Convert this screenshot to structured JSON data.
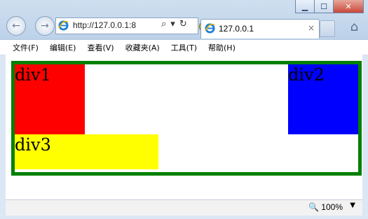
{
  "window": {
    "minimize": "▁",
    "maximize": "☐",
    "close": "✕"
  },
  "nav": {
    "back_icon": "back-arrow-icon",
    "forward_icon": "forward-arrow-icon"
  },
  "address_bar": {
    "url": "http://127.0.0.1:8"
  },
  "tab": {
    "title": "127.0.0.1",
    "close": "×"
  },
  "menu": [
    "文件(F)",
    "编辑(E)",
    "查看(V)",
    "收藏夹(A)",
    "工具(T)",
    "帮助(H)"
  ],
  "page": {
    "div1": {
      "label": "div1",
      "color": "#ff0000"
    },
    "div2": {
      "label": "div2",
      "color": "#0000ff"
    },
    "div3": {
      "label": "div3",
      "color": "#ffff00"
    },
    "border_color": "#008000"
  },
  "status": {
    "zoom": "100%"
  }
}
